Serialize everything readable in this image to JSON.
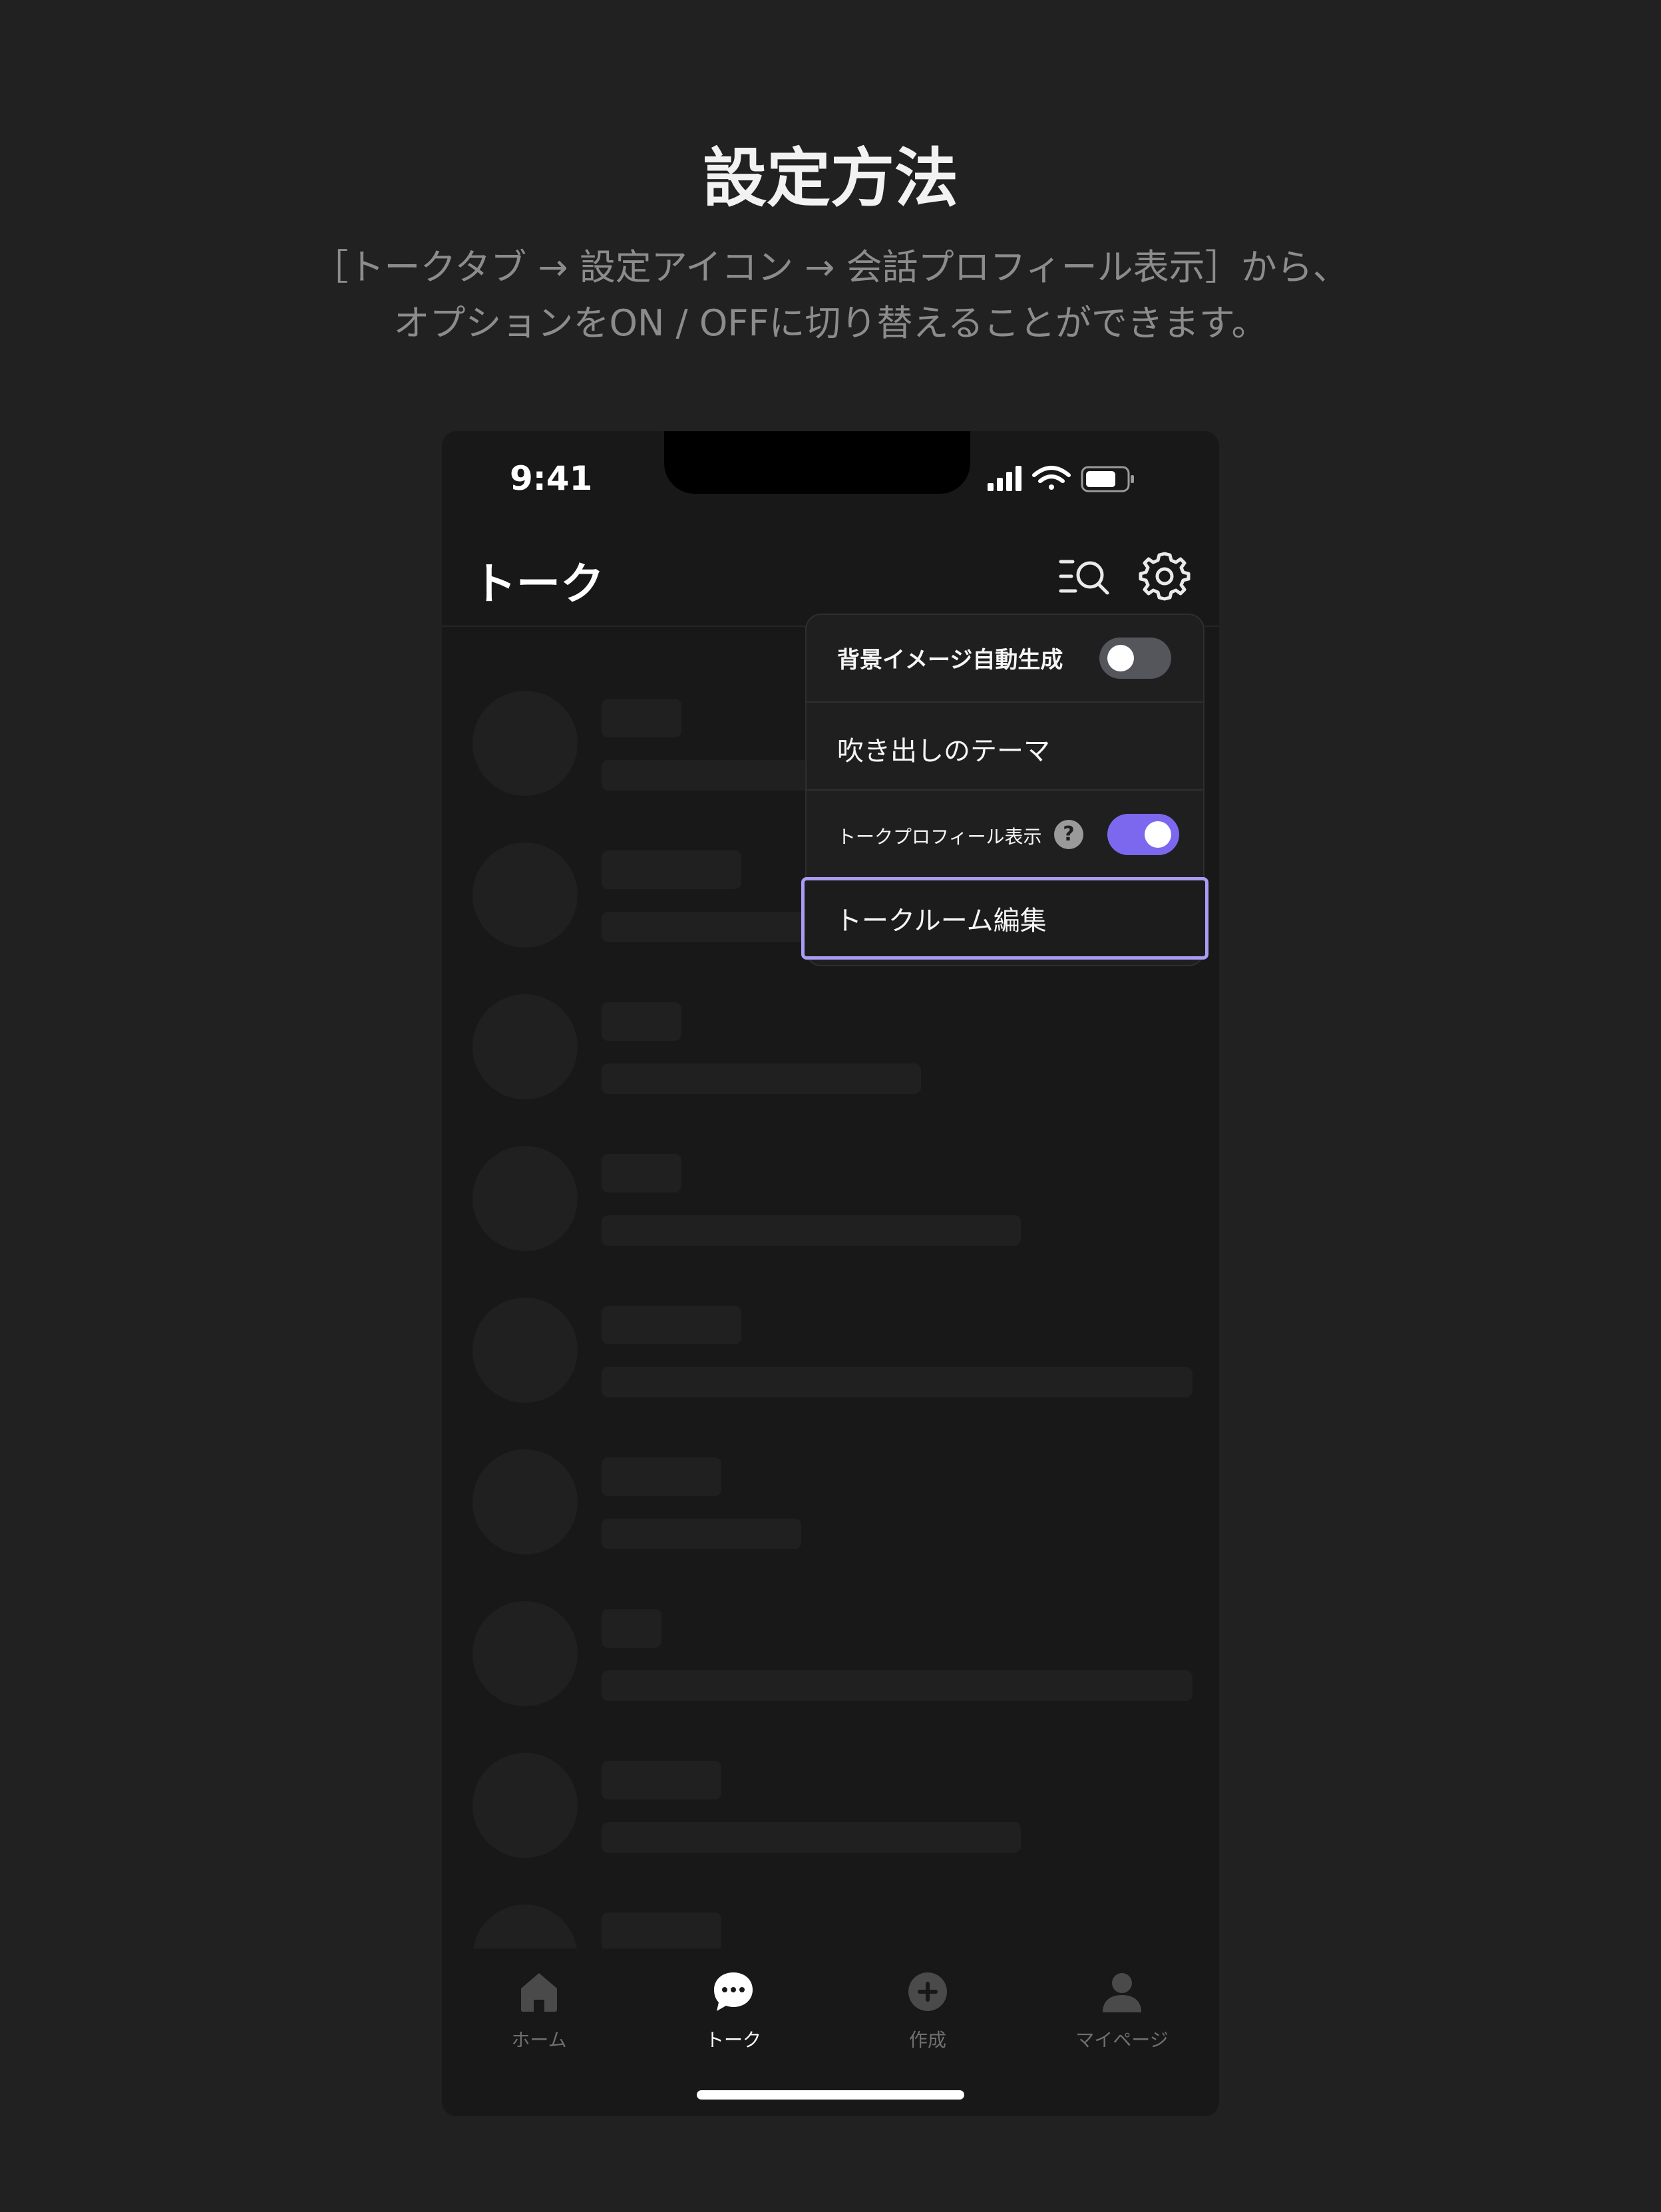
{
  "guide": {
    "heading": "設定方法",
    "subtitle_line1": "［トークタブ → 設定アイコン → 会話プロフィール表示］から、",
    "subtitle_line2": "オプションをON / OFFに切り替えることができます。"
  },
  "status_bar": {
    "time": "9:41",
    "icons": [
      "signal-icon",
      "wifi-icon",
      "battery-icon"
    ]
  },
  "header": {
    "title": "トーク",
    "actions": [
      "search-list-icon",
      "gear-icon"
    ]
  },
  "menu": {
    "items": [
      {
        "label": "背景イメージ自動生成",
        "type": "toggle",
        "on": false
      },
      {
        "label": "吹き出しのテーマ",
        "type": "link"
      },
      {
        "label": "トークプロフィール表示",
        "type": "toggle",
        "on": true,
        "help": "?"
      },
      {
        "label": "トークルーム編集",
        "type": "link",
        "highlighted": true
      }
    ]
  },
  "tabbar": {
    "tabs": [
      {
        "label": "ホーム",
        "icon": "home-icon",
        "active": false
      },
      {
        "label": "トーク",
        "icon": "chat-bubble-icon",
        "active": true
      },
      {
        "label": "作成",
        "icon": "plus-circle-icon",
        "active": false
      },
      {
        "label": "マイページ",
        "icon": "person-icon",
        "active": false
      }
    ]
  },
  "colors": {
    "page_bg": "#212121",
    "phone_bg": "#181818",
    "toggle_on": "#7b68ee",
    "toggle_off": "#55565c",
    "highlight_border": "#a99cf5"
  }
}
